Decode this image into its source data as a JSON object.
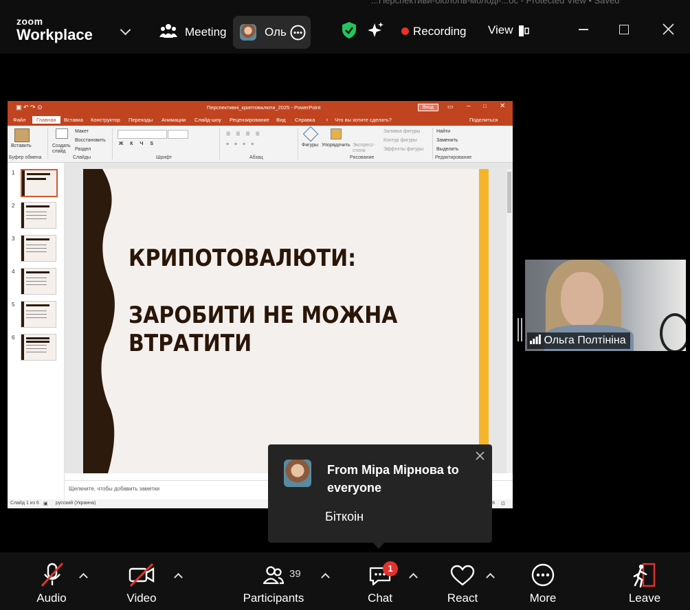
{
  "window": {
    "background_title": "...Перспективи-біологів-молоді-...ос - Protected View • Saved",
    "logo_top": "zoom",
    "logo_bottom": "Workplace",
    "meeting_label": "Meeting",
    "user_short": "Оль",
    "recording_label": "Recording",
    "view_label": "View",
    "colors": {
      "recording": "#e5322d",
      "shield": "#22c55e",
      "leave": "#e5322d"
    }
  },
  "ppt": {
    "title": "Перспективні_криптовалюти_2025  -  PowerPoint",
    "signin": "Вход",
    "tabs": [
      "Файл",
      "Главная",
      "Вставка",
      "Конструктор",
      "Переходы",
      "Анимации",
      "Слайд-шоу",
      "Рецензирование",
      "Вид",
      "Справка"
    ],
    "tellme": "Что вы хотите сделать?",
    "share": "Поделиться",
    "ribbon": {
      "paste": "Вставить",
      "new_slide": "Создать слайд",
      "layout": "Макет",
      "reset": "Восстановить",
      "section": "Раздел",
      "shapes": "Фигуры",
      "arrange": "Упорядочить",
      "quick_styles": "Экспресс-стили",
      "fill": "Заливка фигуры",
      "outline": "Контур фигуры",
      "effects": "Эффекты фигуры",
      "find": "Найти",
      "replace": "Заменить",
      "select": "Выделить",
      "groups": [
        "Буфер обмена",
        "Слайды",
        "Шрифт",
        "Абзац",
        "Рисование",
        "Редактирование"
      ]
    },
    "thumb_numbers": [
      "1",
      "2",
      "3",
      "4",
      "5",
      "6"
    ],
    "slide_title_1": "КРИПОТОВАЛЮТИ:",
    "slide_title_2": "ЗАРОБИТИ НЕ МОЖНА ВТРАТИТИ",
    "notes_placeholder": "Щелкните, чтобы добавить заметки",
    "status_slide": "Слайд 1 из 6",
    "status_lang": "русский (Украина)"
  },
  "participant": {
    "name": "Ольга Полтініна"
  },
  "chat_popup": {
    "from": "From Міра Мірнова to everyone",
    "message": "Біткоін"
  },
  "toolbar": {
    "audio": "Audio",
    "video": "Video",
    "participants": "Participants",
    "participants_count": "39",
    "chat": "Chat",
    "chat_badge": "1",
    "react": "React",
    "more": "More",
    "leave": "Leave"
  }
}
